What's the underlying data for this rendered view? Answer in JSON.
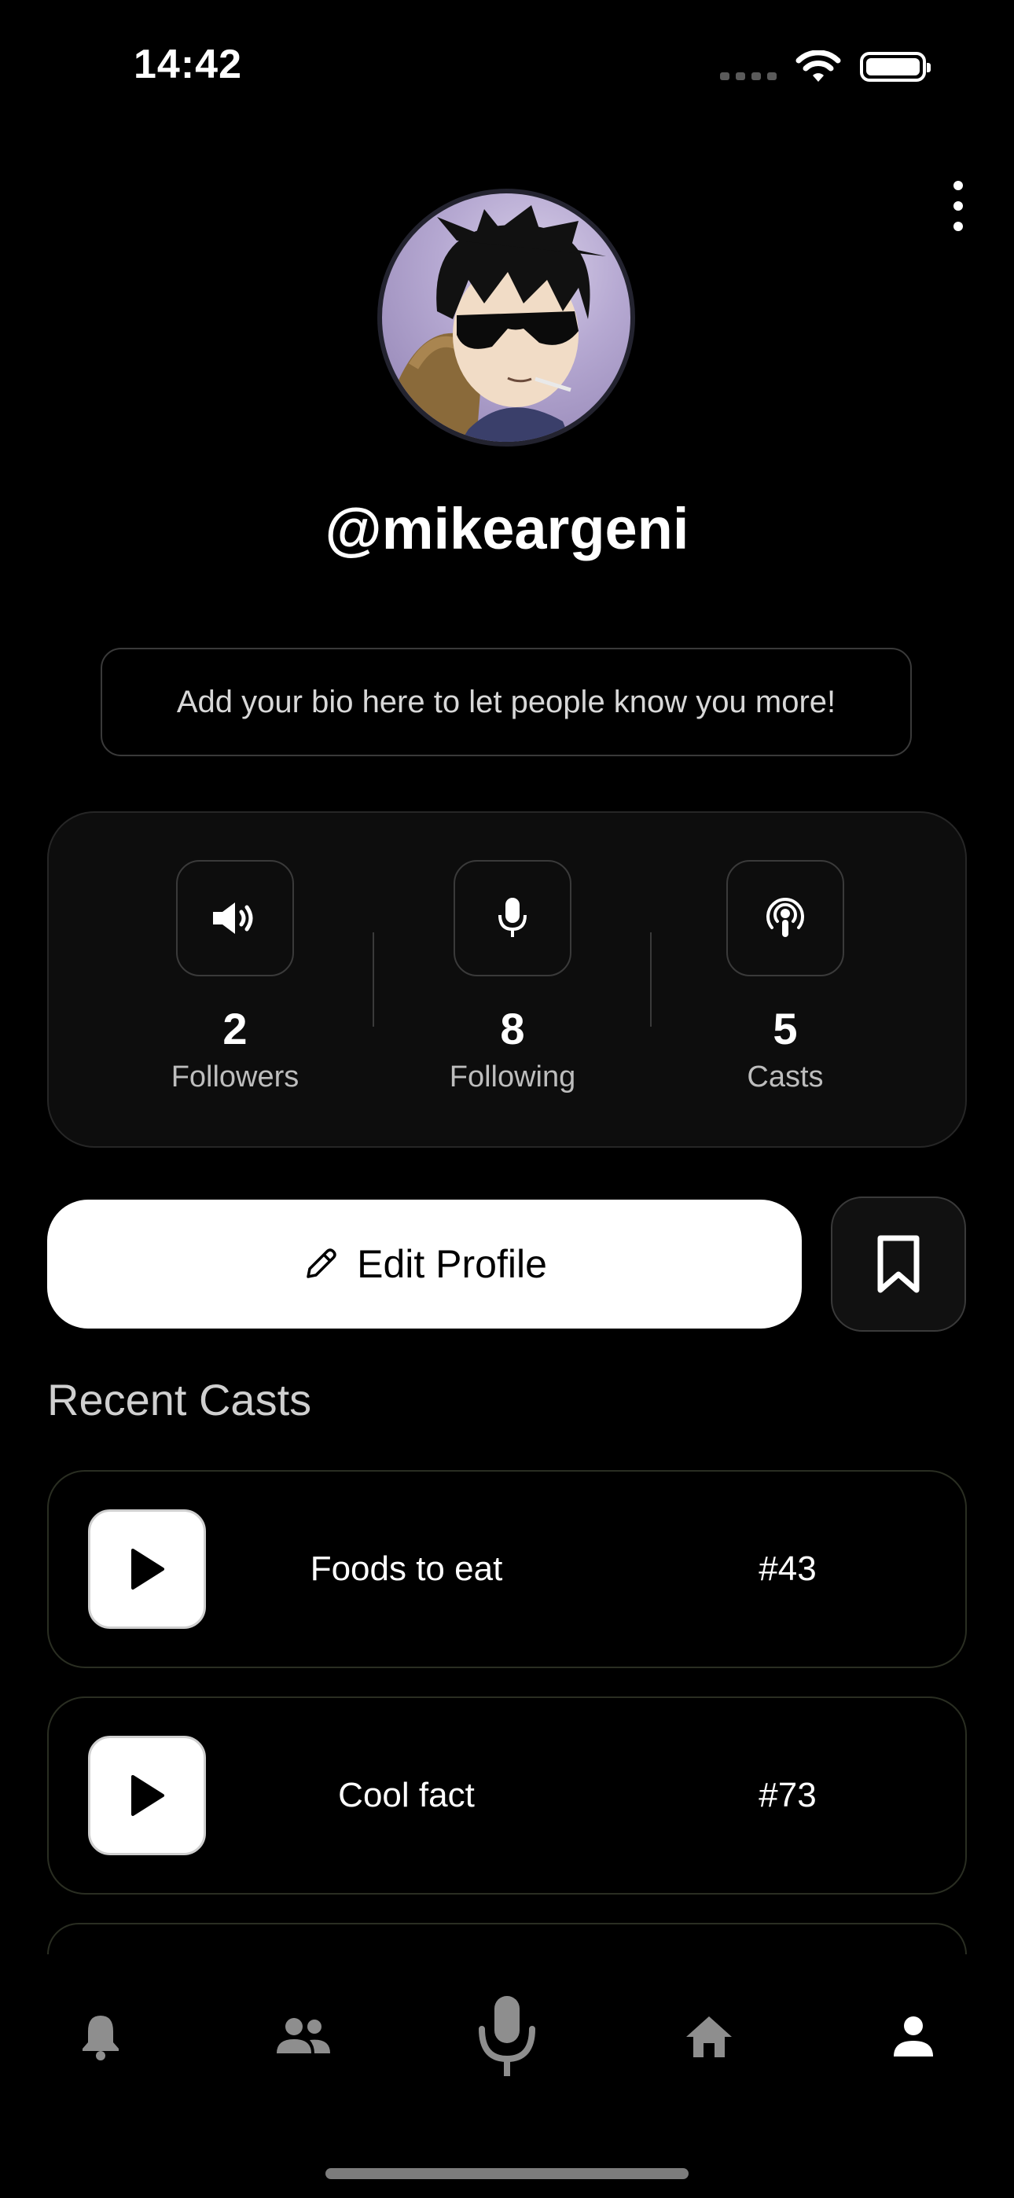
{
  "status_bar": {
    "time": "14:42"
  },
  "profile": {
    "username": "@mikeargeni",
    "bio_placeholder": "Add your bio here to let people know you more!"
  },
  "stats": [
    {
      "icon": "speaker-icon",
      "value": "2",
      "label": "Followers"
    },
    {
      "icon": "microphone-icon",
      "value": "8",
      "label": "Following"
    },
    {
      "icon": "podcast-icon",
      "value": "5",
      "label": "Casts"
    }
  ],
  "actions": {
    "edit_profile_label": "Edit Profile",
    "bookmark_icon": "bookmark-icon"
  },
  "recent_casts": {
    "title": "Recent Casts",
    "items": [
      {
        "title": "Foods to eat",
        "number": "#43"
      },
      {
        "title": "Cool fact",
        "number": "#73"
      }
    ]
  },
  "tab_bar": {
    "items": [
      {
        "icon": "bell-icon",
        "active": false
      },
      {
        "icon": "people-icon",
        "active": false
      },
      {
        "icon": "microphone-icon",
        "active": false
      },
      {
        "icon": "home-icon",
        "active": false
      },
      {
        "icon": "person-icon",
        "active": true
      }
    ]
  },
  "colors": {
    "background": "#000000",
    "card": "#0d0d0d",
    "accent": "#ffffff",
    "inactive_tab": "#8e8e8e"
  }
}
